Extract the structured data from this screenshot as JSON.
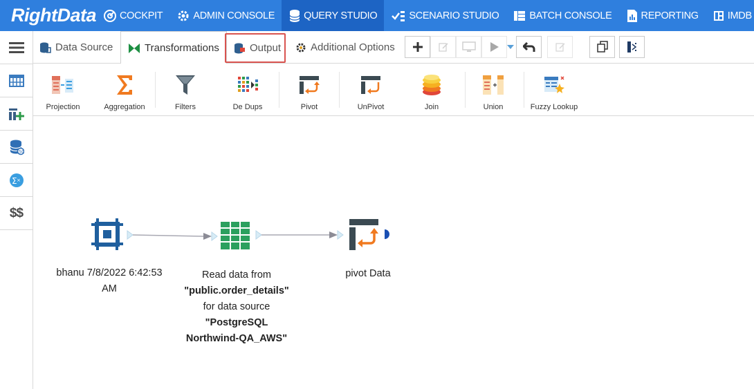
{
  "brand": {
    "logo_text": "RightData"
  },
  "topnav": {
    "items": [
      {
        "label": "COCKPIT",
        "icon": "cockpit-icon"
      },
      {
        "label": "ADMIN CONSOLE",
        "icon": "gear-icon"
      },
      {
        "label": "QUERY STUDIO",
        "icon": "database-icon",
        "active": true
      },
      {
        "label": "SCENARIO STUDIO",
        "icon": "scenario-icon"
      },
      {
        "label": "BATCH CONSOLE",
        "icon": "batch-icon"
      },
      {
        "label": "REPORTING",
        "icon": "report-icon"
      },
      {
        "label": "IMDB",
        "icon": "imdb-icon"
      }
    ],
    "bar_color": "#2f7fde",
    "active_color": "#1d64c4"
  },
  "sidebar": {
    "items": [
      {
        "name": "menu",
        "icon": "hamburger-icon"
      },
      {
        "name": "table",
        "icon": "table-icon"
      },
      {
        "name": "add-table",
        "icon": "add-table-icon"
      },
      {
        "name": "database-query",
        "icon": "database-query-icon"
      },
      {
        "name": "formula",
        "icon": "formula-icon"
      },
      {
        "name": "variables",
        "icon": "dollar-icon",
        "text": "$$"
      }
    ]
  },
  "tabs": {
    "data_source": "Data Source",
    "transformations": "Transformations",
    "output": "Output",
    "additional_options": "Additional Options",
    "highlight_color": "#d9534f"
  },
  "toolbar": {
    "items": [
      {
        "label": "Projection",
        "icon": "projection-icon"
      },
      {
        "label": "Aggregation",
        "icon": "sigma-icon"
      },
      {
        "label": "Filters",
        "icon": "filter-icon"
      },
      {
        "label": "De Dups",
        "icon": "dedup-icon"
      },
      {
        "label": "Pivot",
        "icon": "pivot-icon"
      },
      {
        "label": "UnPivot",
        "icon": "unpivot-icon"
      },
      {
        "label": "Join",
        "icon": "join-icon"
      },
      {
        "label": "Union",
        "icon": "union-icon"
      },
      {
        "label": "Fuzzy Lookup",
        "icon": "fuzzy-lookup-icon"
      }
    ]
  },
  "canvas": {
    "nodes": [
      {
        "type": "source",
        "icon": "source-node-icon",
        "line1": "bhanu 7/8/2022 6:42:53",
        "line2": "AM"
      },
      {
        "type": "read",
        "icon": "table-node-icon",
        "line1": "Read data from",
        "table": "\"public.order_details\"",
        "line3": "for data source",
        "source_line1": "\"PostgreSQL",
        "source_line2": "Northwind-QA_AWS\""
      },
      {
        "type": "pivot",
        "icon": "pivot-node-icon",
        "line1": "pivot Data"
      }
    ]
  }
}
